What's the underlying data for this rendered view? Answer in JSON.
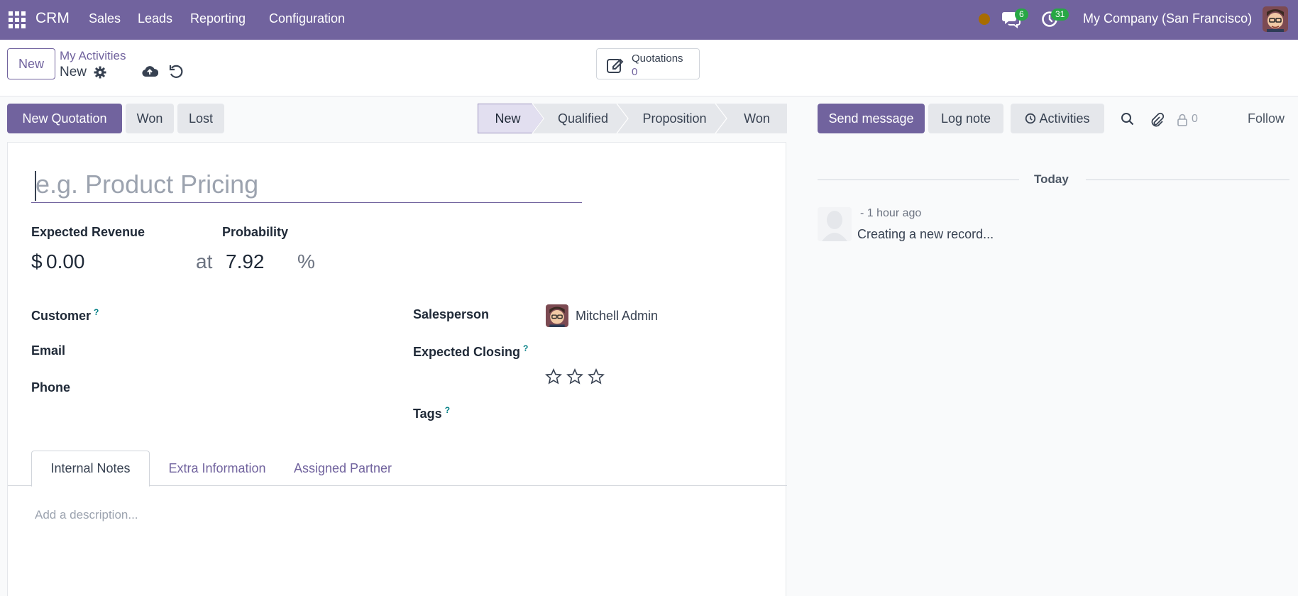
{
  "navbar": {
    "brand": "CRM",
    "menu": [
      "Sales",
      "Leads",
      "Reporting",
      "Configuration"
    ],
    "messages_count": "6",
    "activities_count": "31",
    "company": "My Company (San Francisco)"
  },
  "control_panel": {
    "new_label": "New",
    "breadcrumb_parent": "My Activities",
    "breadcrumb_current": "New",
    "quotations_label": "Quotations",
    "quotations_count": "0"
  },
  "actions": {
    "new_quotation": "New Quotation",
    "won": "Won",
    "lost": "Lost"
  },
  "stages": [
    {
      "label": "New",
      "active": true
    },
    {
      "label": "Qualified",
      "active": false
    },
    {
      "label": "Proposition",
      "active": false
    },
    {
      "label": "Won",
      "active": false
    }
  ],
  "form": {
    "title_placeholder": "e.g. Product Pricing",
    "expected_revenue_label": "Expected Revenue",
    "probability_label": "Probability",
    "currency_symbol": "$",
    "expected_revenue_value": "0.00",
    "at_label": "at",
    "probability_value": "7.92",
    "percent_label": "%",
    "customer_label": "Customer",
    "email_label": "Email",
    "phone_label": "Phone",
    "salesperson_label": "Salesperson",
    "salesperson_value": "Mitchell Admin",
    "expected_closing_label": "Expected Closing",
    "tags_label": "Tags",
    "help_mark": "?",
    "priority_stars": 0,
    "priority_max": 3
  },
  "tabs": [
    "Internal Notes",
    "Extra Information",
    "Assigned Partner"
  ],
  "description_placeholder": "Add a description...",
  "chatter": {
    "send_message": "Send message",
    "log_note": "Log note",
    "activities": "Activities",
    "followers_count": "0",
    "follow": "Follow",
    "date_separator": "Today",
    "message_time": "- 1 hour ago",
    "message_body": "Creating a new record..."
  },
  "colors": {
    "brand": "#71639e",
    "badge": "#28a745",
    "help": "#017e84"
  }
}
